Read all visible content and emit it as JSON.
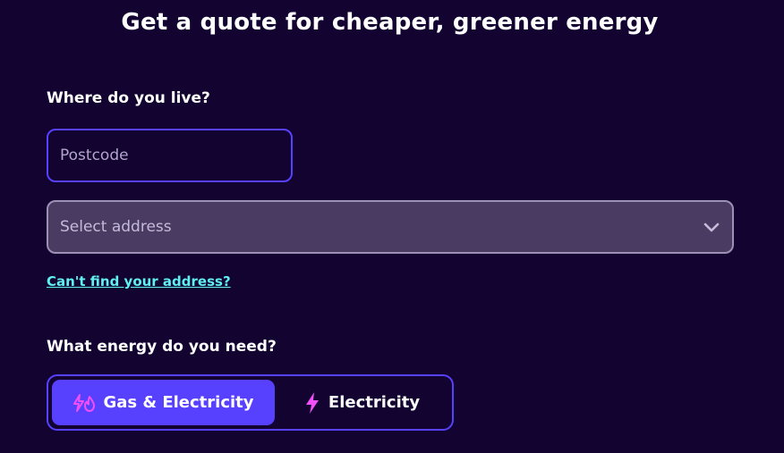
{
  "header": {
    "title": "Get a quote for cheaper, greener energy"
  },
  "location": {
    "label": "Where do you live?",
    "postcode_placeholder": "Postcode",
    "postcode_value": "",
    "address_placeholder": "Select address",
    "cant_find_link": "Can't find your address?"
  },
  "energy": {
    "label": "What energy do you need?",
    "options": [
      {
        "label": "Gas & Electricity",
        "icon": "gas-electricity-icon",
        "selected": true
      },
      {
        "label": "Electricity",
        "icon": "lightning-bolt-icon",
        "selected": false
      }
    ]
  },
  "colors": {
    "background": "#120330",
    "accent": "#5840ff",
    "link": "#5ff0f0",
    "icon_pink": "#f050f8",
    "select_background": "#4a3b63"
  }
}
